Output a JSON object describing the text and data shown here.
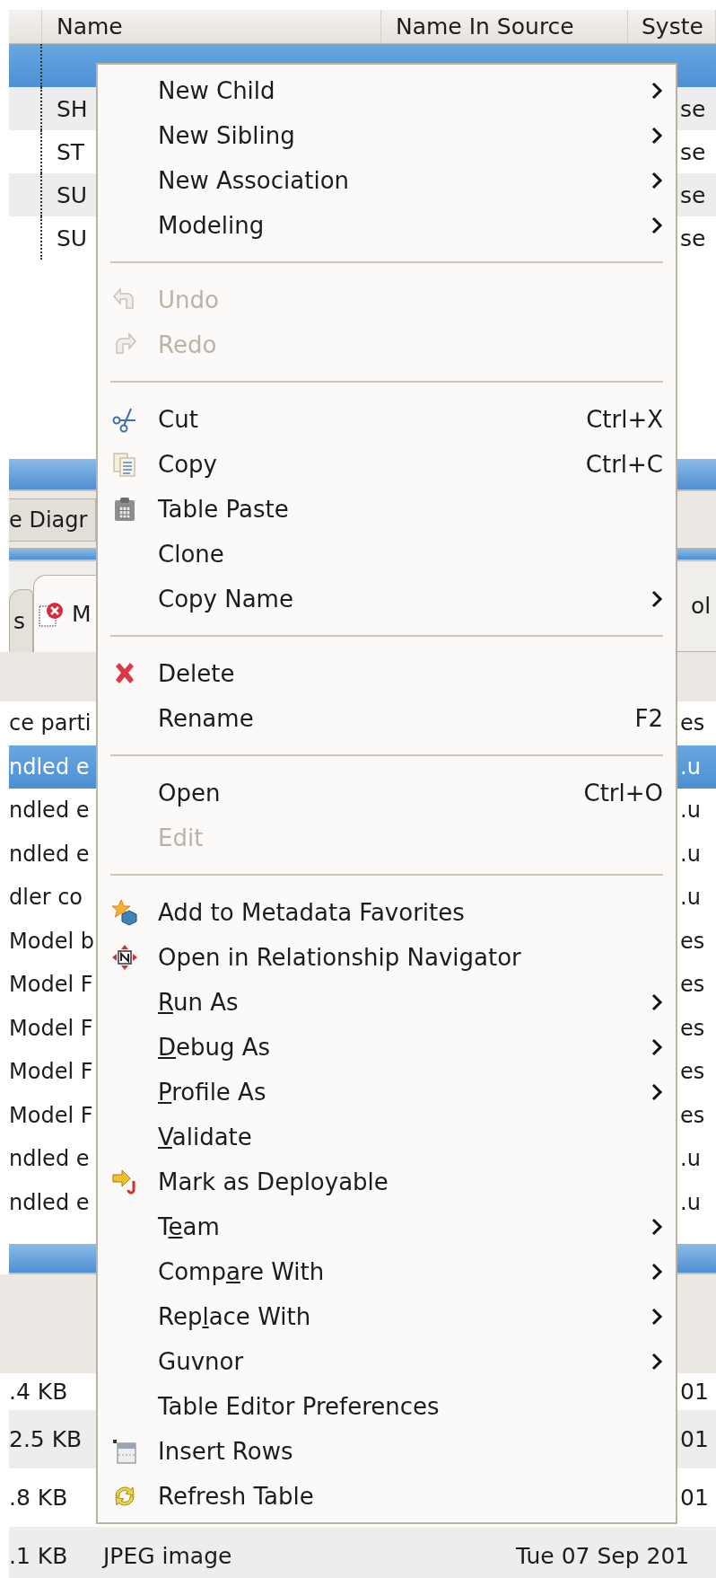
{
  "model_table": {
    "columns": [
      "Name",
      "Name In Source",
      "Syste"
    ],
    "rows": [
      {
        "selected": true
      },
      {
        "name": "SH",
        "column_3": "se",
        "selected": false
      },
      {
        "name": "ST",
        "column_3": "se",
        "selected": false
      },
      {
        "name": "SU",
        "column_3": "se",
        "selected": false
      },
      {
        "name": "SU",
        "column_3": "se",
        "selected": false
      }
    ]
  },
  "diagram_tab": {
    "label": "e Diagr"
  },
  "view_tabs": [
    {
      "label": "s",
      "selected": false
    },
    {
      "label": "M",
      "selected": true
    }
  ],
  "view_tab_right": {
    "label": "ol"
  },
  "problems_list": {
    "rows": [
      {
        "column_1": "ce parti",
        "column_2": "es",
        "selected": false
      },
      {
        "column_1": "ndled e",
        "column_2": ".u",
        "selected": true
      },
      {
        "column_1": "ndled e",
        "column_2": ".u",
        "selected": false
      },
      {
        "column_1": "ndled e",
        "column_2": ".u",
        "selected": false
      },
      {
        "column_1": "dler co",
        "column_2": ".u",
        "selected": false
      },
      {
        "column_1": "Model b",
        "column_2": "es",
        "selected": false
      },
      {
        "column_1": "Model F",
        "column_2": "es",
        "selected": false
      },
      {
        "column_1": "Model F",
        "column_2": "es",
        "selected": false
      },
      {
        "column_1": "Model F",
        "column_2": "es",
        "selected": false
      },
      {
        "column_1": "Model F",
        "column_2": "es",
        "selected": false
      },
      {
        "column_1": "ndled e",
        "column_2": ".u",
        "selected": false
      },
      {
        "column_1": "ndled e",
        "column_2": ".u",
        "selected": false
      }
    ]
  },
  "file_list": {
    "rows": [
      {
        "size": ".4 KB",
        "date": "01"
      },
      {
        "size": "2.5 KB",
        "date": "01"
      },
      {
        "size": ".8 KB",
        "date": "01"
      },
      {
        "size": ".1 KB",
        "type": "JPEG image",
        "date": "Tue 07 Sep 201"
      }
    ]
  },
  "context_menu": {
    "items": [
      {
        "kind": "item",
        "label": "New Child",
        "submenu": true,
        "disabled": false
      },
      {
        "kind": "item",
        "label": "New Sibling",
        "submenu": true,
        "disabled": false
      },
      {
        "kind": "item",
        "label": "New Association",
        "submenu": true,
        "disabled": false
      },
      {
        "kind": "item",
        "label": "Modeling",
        "submenu": true,
        "disabled": false
      },
      {
        "kind": "separator"
      },
      {
        "kind": "item",
        "label": "Undo",
        "submenu": false,
        "disabled": true
      },
      {
        "kind": "item",
        "label": "Redo",
        "submenu": false,
        "disabled": true
      },
      {
        "kind": "separator"
      },
      {
        "kind": "item",
        "label": "Cut",
        "shortcut": "Ctrl+X",
        "submenu": false,
        "disabled": false
      },
      {
        "kind": "item",
        "label": "Copy",
        "shortcut": "Ctrl+C",
        "submenu": false,
        "disabled": false
      },
      {
        "kind": "item",
        "label": "Table Paste",
        "submenu": false,
        "disabled": false
      },
      {
        "kind": "item",
        "label": "Clone",
        "submenu": false,
        "disabled": false
      },
      {
        "kind": "item",
        "label": "Copy Name",
        "submenu": true,
        "disabled": false
      },
      {
        "kind": "separator"
      },
      {
        "kind": "item",
        "label": "Delete",
        "submenu": false,
        "disabled": false
      },
      {
        "kind": "item",
        "label": "Rename",
        "shortcut": "F2",
        "submenu": false,
        "disabled": false
      },
      {
        "kind": "separator"
      },
      {
        "kind": "item",
        "label": "Open",
        "shortcut": "Ctrl+O",
        "submenu": false,
        "disabled": false
      },
      {
        "kind": "item",
        "label": "Edit",
        "submenu": false,
        "disabled": true
      },
      {
        "kind": "separator"
      },
      {
        "kind": "item",
        "label": "Add to Metadata Favorites",
        "submenu": false,
        "disabled": false
      },
      {
        "kind": "item",
        "label": "Open in Relationship Navigator",
        "submenu": false,
        "disabled": false
      },
      {
        "kind": "item",
        "label_key": "R",
        "label_after": "un As",
        "submenu": true,
        "disabled": false
      },
      {
        "kind": "item",
        "label_key": "D",
        "label_after": "ebug As",
        "submenu": true,
        "disabled": false
      },
      {
        "kind": "item",
        "label_key": "P",
        "label_after": "rofile As",
        "submenu": true,
        "disabled": false
      },
      {
        "kind": "item",
        "label_key": "V",
        "label_after": "alidate",
        "submenu": false,
        "disabled": false
      },
      {
        "kind": "item",
        "label": "Mark as Deployable",
        "submenu": false,
        "disabled": false
      },
      {
        "kind": "item",
        "label_before": "T",
        "label_key": "e",
        "label_after": "am",
        "submenu": true,
        "disabled": false
      },
      {
        "kind": "item",
        "label_before": "Comp",
        "label_key": "a",
        "label_after": "re With",
        "submenu": true,
        "disabled": false
      },
      {
        "kind": "item",
        "label_before": "Rep",
        "label_key": "l",
        "label_after": "ace With",
        "submenu": true,
        "disabled": false
      },
      {
        "kind": "item",
        "label": "Guvnor",
        "submenu": true,
        "disabled": false
      },
      {
        "kind": "item",
        "label": "Table Editor Preferences",
        "submenu": false,
        "disabled": false
      },
      {
        "kind": "item",
        "label": "Insert Rows",
        "submenu": false,
        "disabled": false
      },
      {
        "kind": "item",
        "label": "Refresh Table",
        "submenu": false,
        "disabled": false
      }
    ]
  }
}
